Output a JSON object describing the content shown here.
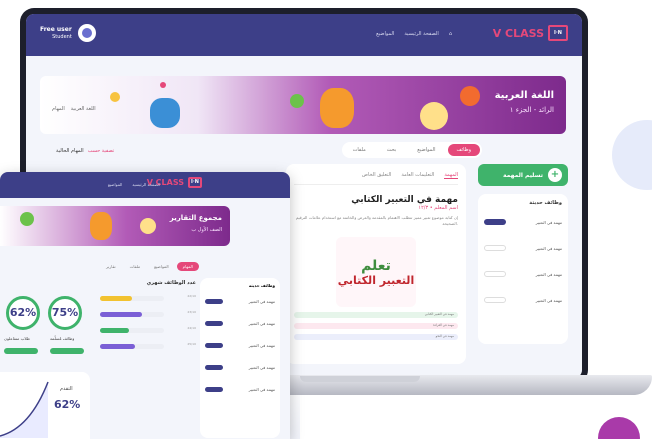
{
  "laptop": {
    "brand": "V CLASS",
    "brand_box": "I·N",
    "nav": [
      "الصفحة الرئيسية",
      "المواضيع"
    ],
    "user": {
      "name": "Free user",
      "role": "Student"
    },
    "banner": {
      "title": "اللغة العربية",
      "subtitle": "الرائد - الجزء ١",
      "crumbs": [
        "اللغة العربية",
        "المهام"
      ]
    },
    "tabs": [
      "وظائف",
      "المواضيع",
      "بحث",
      "ملفات"
    ],
    "filter_prefix": "تصفية حسب",
    "filter_value": "المهام الحالية",
    "add_button": "تسليم المهمة",
    "sidebar": {
      "title": "وظائف حديثة",
      "items": [
        "مهمة في التعبير",
        "مهمة في التعبير",
        "مهمة في التعبير",
        "مهمة في التعبير"
      ]
    },
    "card": {
      "tabs": [
        "المهمة",
        "التعليمات العامة",
        "التعليق الخاص"
      ],
      "title": "مهمة في التعبير الكتابي",
      "meta": "اسم المعلم • ١٢/٣",
      "desc": "إن كتابة موضوع تعبير مميز تتطلب الاهتمام بالمقدمة والعرض والخاتمة مع استخدام علامات الترقيم الصحيحة.",
      "poster_a": "تعلم",
      "poster_b": "التعبير الكتابي",
      "chips": [
        "مهمة في التعبير الكتابي",
        "مهمة في القراءة",
        "مهمة في النحو"
      ]
    }
  },
  "tablet": {
    "brand": "V CLASS",
    "brand_box": "I·N",
    "nav": [
      "الصفحة الرئيسية",
      "المواضيع"
    ],
    "banner": {
      "title": "مجموع التقارير",
      "subtitle": "الصف الأول ب"
    },
    "tabs": [
      "المهام",
      "المواضيع",
      "ملفات",
      "تقارير"
    ],
    "kpi1": {
      "value": "62%",
      "label": "طلاب متفاعلون"
    },
    "kpi2": {
      "value": "75%",
      "label": "وظائف مُسلّمة"
    },
    "mid": {
      "title": "عدد الوظائف شهري",
      "rows": [
        "22/10",
        "23/10",
        "24/10",
        "25/10"
      ]
    },
    "progress": {
      "title": "التقدم",
      "value": "62%"
    },
    "sidebar": {
      "title": "وظائف حديثة",
      "items": [
        "مهمة في التعبير",
        "مهمة في التعبير",
        "مهمة في التعبير",
        "مهمة في التعبير",
        "مهمة في التعبير"
      ]
    }
  },
  "colors": {
    "navy": "#3d3f88",
    "pink": "#e5487a",
    "green": "#3fb36b",
    "purple": "#7d2a8c"
  }
}
